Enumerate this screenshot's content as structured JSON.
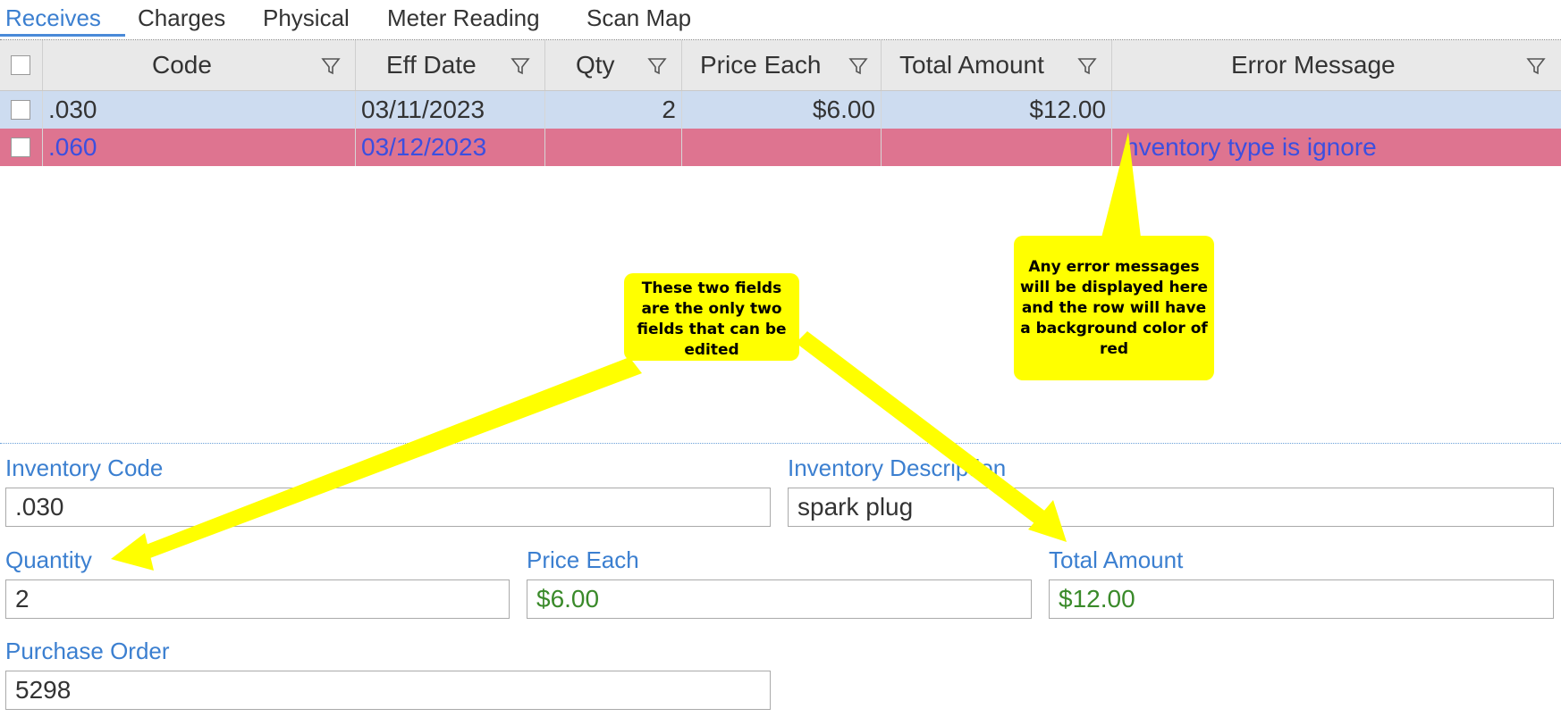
{
  "tabs": [
    "Receives",
    "Charges",
    "Physical",
    "Meter Reading",
    "Scan Map"
  ],
  "active_tab": "Receives",
  "grid": {
    "columns": [
      "Code",
      "Eff Date",
      "Qty",
      "Price Each",
      "Total Amount",
      "Error Message"
    ],
    "rows": [
      {
        "code": ".030",
        "eff_date": "03/11/2023",
        "qty": "2",
        "price_each": "$6.00",
        "total_amount": "$12.00",
        "error_message": ""
      },
      {
        "code": ".060",
        "eff_date": "03/12/2023",
        "qty": "",
        "price_each": "",
        "total_amount": "",
        "error_message": "nventory type is ignore"
      }
    ],
    "row_colors": {
      "selected": "#cddcf0",
      "error": "#de7490"
    }
  },
  "form": {
    "inventory_code_label": "Inventory Code",
    "inventory_code_value": ".030",
    "inventory_description_label": "Inventory Description",
    "inventory_description_value": "spark plug",
    "quantity_label": "Quantity",
    "quantity_value": "2",
    "price_each_label": "Price Each",
    "price_each_value": "$6.00",
    "total_amount_label": "Total Amount",
    "total_amount_value": "$12.00",
    "purchase_order_label": "Purchase Order",
    "purchase_order_value": "5298"
  },
  "callouts": {
    "editable_fields": "These two fields are the only two fields that can be edited",
    "error_messages": "Any error messages will be displayed here and the row will have a background color of red"
  },
  "colors": {
    "accent": "#3b7fd0",
    "callout": "#ffff00",
    "editable_value": "#3a8a2a"
  }
}
